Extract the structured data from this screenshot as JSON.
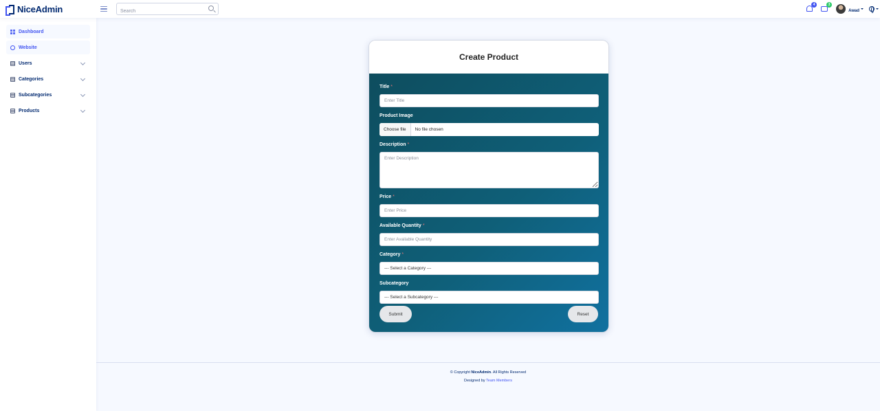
{
  "brand": {
    "name": "NiceAdmin"
  },
  "header": {
    "search_placeholder": "Search",
    "notifications_count": "4",
    "messages_count": "3",
    "user_name": "Awad"
  },
  "sidebar": {
    "items": [
      {
        "label": "Dashboard",
        "icon": "grid-icon",
        "expandable": false
      },
      {
        "label": "Website",
        "icon": "globe-icon",
        "expandable": false
      },
      {
        "label": "Users",
        "icon": "list-icon",
        "expandable": true
      },
      {
        "label": "Categories",
        "icon": "list-icon",
        "expandable": true
      },
      {
        "label": "Subcategories",
        "icon": "list-icon",
        "expandable": true
      },
      {
        "label": "Products",
        "icon": "list-icon",
        "expandable": true
      }
    ]
  },
  "form": {
    "title": "Create Product",
    "fields": {
      "title": {
        "label": "Title",
        "required": "*",
        "placeholder": "Enter Title"
      },
      "image": {
        "label": "Product Image",
        "button": "Choose file",
        "status": "No file chosen"
      },
      "description": {
        "label": "Description",
        "required": "*",
        "placeholder": "Enter Description"
      },
      "price": {
        "label": "Price",
        "required": "*",
        "placeholder": "Enter Price"
      },
      "quantity": {
        "label": "Available Quantity",
        "required": "*",
        "placeholder": "Enter Available Quantity"
      },
      "category": {
        "label": "Category",
        "required": "*",
        "selected": "--- Select a Category ---"
      },
      "subcategory": {
        "label": "Subcategory",
        "selected": "--- Select a Subcategory ---"
      }
    },
    "submit_label": "Submit",
    "reset_label": "Reset"
  },
  "footer": {
    "copyright_prefix": "© Copyright ",
    "copyright_brand": "NiceAdmin",
    "copyright_suffix": ". All Rights Reserved",
    "designed_prefix": "Designed by ",
    "designed_link": "Team Members"
  },
  "colors": {
    "brand_primary": "#4154f1",
    "brand_dark": "#012970",
    "card_gradient_start": "#0e4d5e",
    "card_gradient_end": "#1171a0",
    "page_background": "#f6f9ff"
  }
}
